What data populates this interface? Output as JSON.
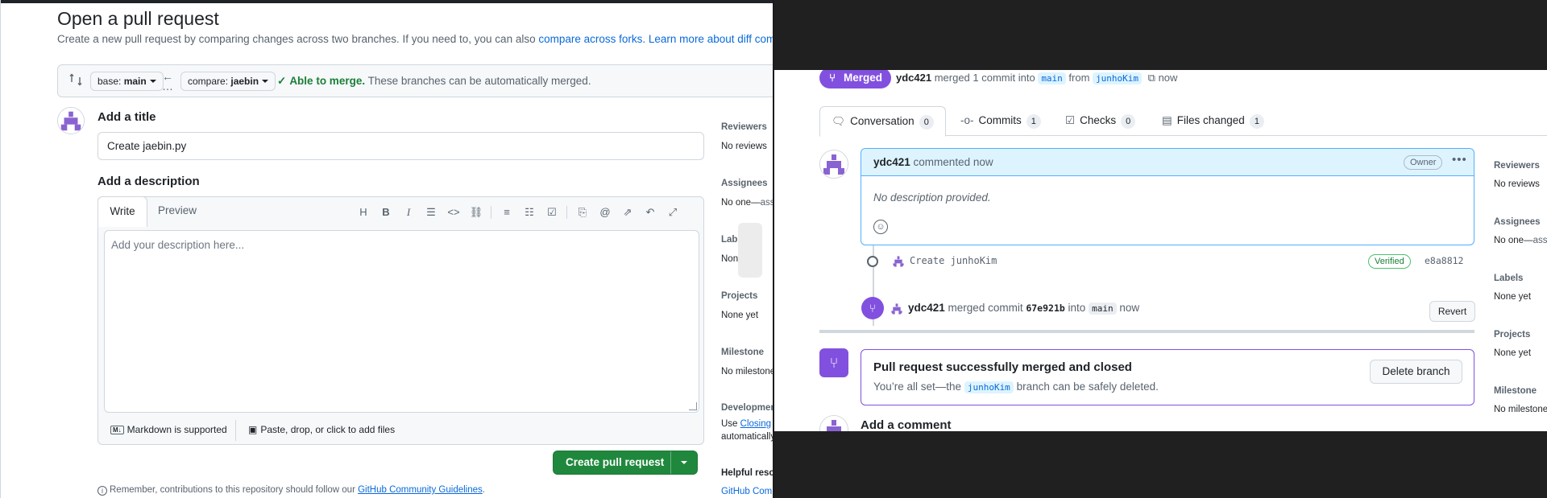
{
  "left": {
    "page_title": "Open a pull request",
    "subtitle_prefix": "Create a new pull request by comparing changes across two branches. If you need to, you can also ",
    "compare_forks_link": "compare across forks.",
    "learn_more_link": "Learn more about diff comparis",
    "base_branch_prefix": "base: ",
    "base_branch": "main",
    "compare_branch_prefix": "compare: ",
    "compare_branch": "jaebin",
    "able_to_merge": "Able to merge.",
    "merge_note": " These branches can be automatically merged.",
    "add_title_label": "Add a title",
    "title_value": "Create jaebin.py",
    "add_description_label": "Add a description",
    "tab_write": "Write",
    "tab_preview": "Preview",
    "description_placeholder": "Add your description here...",
    "markdown_note": "Markdown is supported",
    "attach_note": "Paste, drop, or click to add files",
    "create_button": "Create pull request",
    "reminder_prefix": "Remember, contributions to this repository should follow our ",
    "guidelines_link": "GitHub Community Guidelines",
    "reminder_suffix": ".",
    "sidebar": {
      "reviewers": "Reviewers",
      "reviewers_value": "No reviews",
      "assignees": "Assignees",
      "assignees_value": "No one—",
      "assignees_link": "assi",
      "labels": "Labels",
      "labels_value": "None yet",
      "projects": "Projects",
      "projects_value": "None yet",
      "milestone": "Milestone",
      "milestone_value": "No milestone",
      "development": "Developmen",
      "development_prefix": "Use ",
      "development_link": "Closing",
      "development_line2": "automatically",
      "helpful": "Helpful reso",
      "helpful_link": "GitHub Comm"
    }
  },
  "right": {
    "merged_badge": "Merged",
    "merge_author": "ydc421",
    "merge_text": " merged 1 commit into ",
    "target_branch": "main",
    "from_text": " from ",
    "source_branch": "junhoKim",
    "merge_time": "now",
    "tabs": [
      {
        "label": "Conversation",
        "count": "0"
      },
      {
        "label": "Commits",
        "count": "1"
      },
      {
        "label": "Checks",
        "count": "0"
      },
      {
        "label": "Files changed",
        "count": "1"
      }
    ],
    "comment_author": "ydc421",
    "comment_action": " commented now",
    "owner_badge": "Owner",
    "comment_body": "No description provided.",
    "commit_message": "Create junhoKim",
    "verified_badge": "Verified",
    "commit_sha": "e8a8812",
    "merge_event_author": "ydc421",
    "merge_event_text": " merged commit ",
    "merge_event_sha": "67e921b",
    "merge_event_into": " into ",
    "merge_event_branch": "main",
    "merge_event_time": " now",
    "revert_button": "Revert",
    "merged_box_title": "Pull request successfully merged and closed",
    "merged_box_prefix": "You’re all set—the ",
    "merged_box_branch": "junhoKim",
    "merged_box_suffix": " branch can be safely deleted.",
    "delete_branch_button": "Delete branch",
    "add_comment": "Add a comment",
    "sidebar": {
      "reviewers": "Reviewers",
      "reviewers_value": "No reviews",
      "assignees": "Assignees",
      "assignees_value": "No one—",
      "assignees_link": "assi",
      "labels": "Labels",
      "labels_value": "None yet",
      "projects": "Projects",
      "projects_value": "None yet",
      "milestone": "Milestone",
      "milestone_value": "No milestone"
    }
  },
  "colors": {
    "accent_blue": "#0969da",
    "merge_purple": "#8250df",
    "success_green": "#1f883d",
    "border": "#d0d7de"
  }
}
